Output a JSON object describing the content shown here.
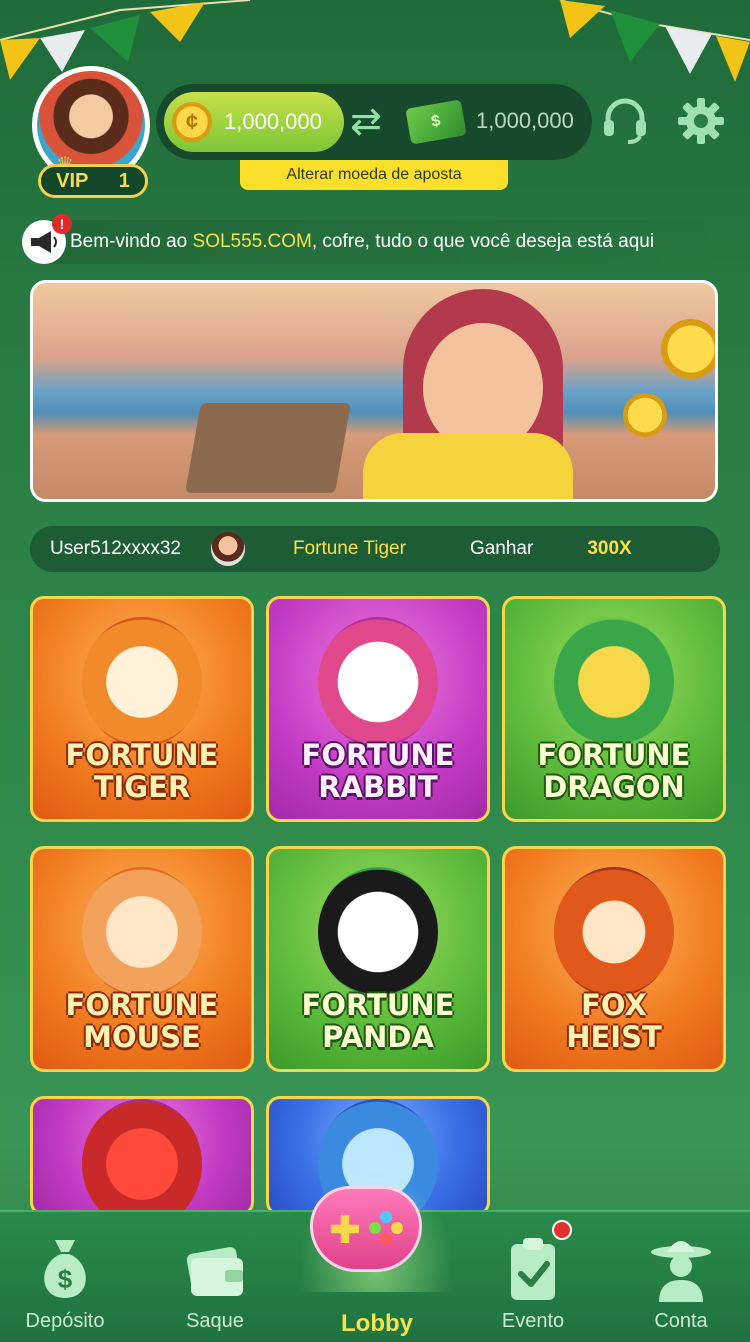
{
  "header": {
    "vip_label": "VIP",
    "vip_level": "1",
    "coin_balance": "1,000,000",
    "cash_balance": "1,000,000",
    "change_currency_label": "Alterar moeda de aposta"
  },
  "marquee": {
    "prefix": "Bem-vindo ao ",
    "site": "SOL555.COM",
    "suffix": ", cofre, tudo o que você deseja está aqui"
  },
  "ticker": {
    "user": "User512xxxx32",
    "game": "Fortune Tiger",
    "win_label": "Ganhar",
    "multiplier": "300X"
  },
  "games": [
    {
      "title": "FORTUNE\nTIGER"
    },
    {
      "title": "FORTUNE\nRABBIT"
    },
    {
      "title": "FORTUNE\nDRAGON"
    },
    {
      "title": "FORTUNE\nMOUSE"
    },
    {
      "title": "FORTUNE\nPANDA"
    },
    {
      "title": "FOX\nHEIST"
    }
  ],
  "nav": {
    "deposit": "Depósito",
    "withdraw": "Saque",
    "lobby": "Lobby",
    "event": "Evento",
    "account": "Conta"
  },
  "colors": {
    "background": "#2a7d44",
    "accent_yellow": "#f7e24a",
    "tile_border": "#f7d54d"
  }
}
